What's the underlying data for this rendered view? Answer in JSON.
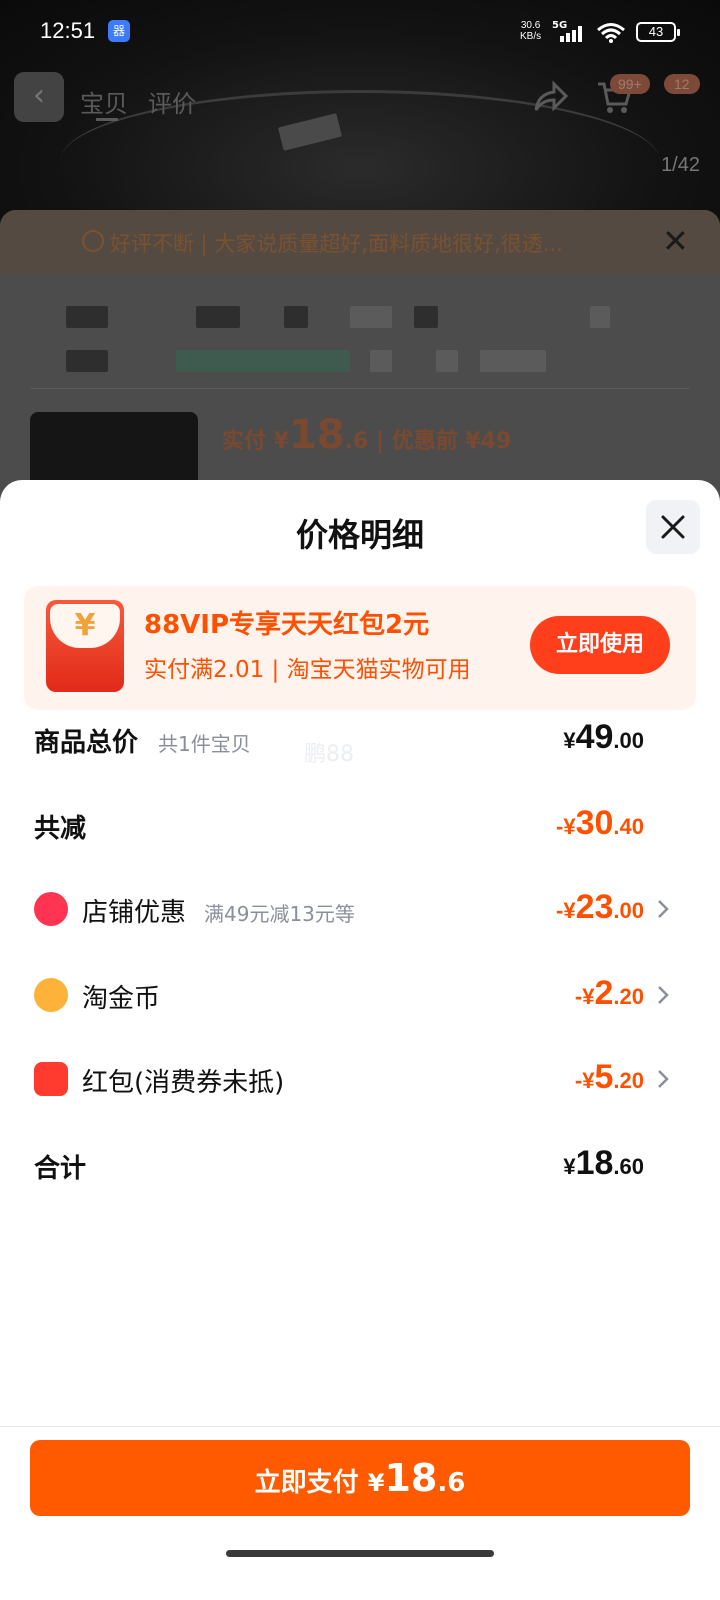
{
  "status_bar": {
    "time": "12:51",
    "app_icon_glyph": "器",
    "net_speed_value": "30.6",
    "net_speed_unit": "KB/s",
    "network": "5G",
    "battery": "43",
    "icons": [
      "signal-icon",
      "wifi-icon",
      "battery-icon"
    ]
  },
  "background_page": {
    "tabs": [
      "宝贝",
      "评价"
    ],
    "cart_badge": "99+",
    "message_badge": "12",
    "image_counter": "1/42",
    "banner_text": "好评不断 | 大家说质量超好,面料质地很好,很透...",
    "paid_label": "实付",
    "paid_currency": "¥",
    "paid_int": "18",
    "paid_dec": ".6",
    "original_label": "| 优惠前 ¥49"
  },
  "sheet": {
    "title": "价格明细",
    "promo": {
      "icon_glyph": "¥",
      "title": "88VIP专享天天红包2元",
      "subtitle": "实付满2.01 | 淘宝天猫实物可用",
      "button_label": "立即使用"
    },
    "watermark": "鹏88",
    "rows": [
      {
        "label": "商品总价",
        "sub": "共1件宝贝",
        "currency": "¥",
        "int": "49",
        "dec": ".00"
      },
      {
        "label": "共减",
        "currency": "-¥",
        "int": "30",
        "dec": ".40"
      },
      {
        "label": "店铺优惠",
        "sub": "满49元减13元等",
        "currency": "-¥",
        "int": "23",
        "dec": ".00",
        "icon": "shop-icon"
      },
      {
        "label": "淘金币",
        "currency": "-¥",
        "int": "2",
        "dec": ".20",
        "icon": "coin-icon"
      },
      {
        "label": "红包(消费券未抵)",
        "currency": "-¥",
        "int": "5",
        "dec": ".20",
        "icon": "red-packet-icon"
      },
      {
        "label": "合计",
        "currency": "¥",
        "int": "18",
        "dec": ".60"
      }
    ],
    "pay_button": {
      "label": "立即支付",
      "currency": "¥",
      "int": "18",
      "dec": ".6"
    }
  },
  "colors": {
    "accent_orange": "#ff5000",
    "pay_button": "#ff5a00",
    "promo_bg": "#fff3ee",
    "promo_button": "#ff3f1c"
  }
}
